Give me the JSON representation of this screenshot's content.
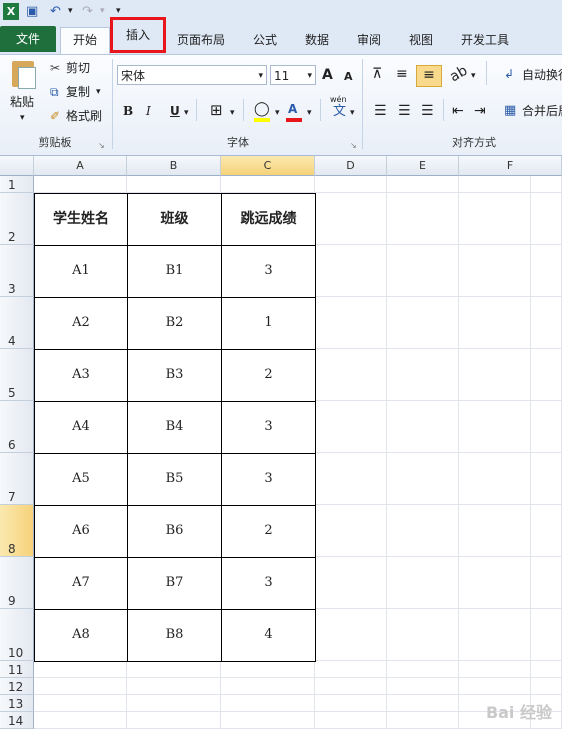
{
  "qat": {
    "excel_icon": "excel-app-icon",
    "save_icon": "save-icon",
    "undo_icon": "undo-icon",
    "redo_icon": "redo-icon"
  },
  "tabs": [
    {
      "label": "文件"
    },
    {
      "label": "开始"
    },
    {
      "label": "插入"
    },
    {
      "label": "页面布局"
    },
    {
      "label": "公式"
    },
    {
      "label": "数据"
    },
    {
      "label": "审阅"
    },
    {
      "label": "视图"
    },
    {
      "label": "开发工具"
    }
  ],
  "clipboard": {
    "paste": "粘贴",
    "cut": "剪切",
    "copy": "复制",
    "format_painter": "格式刷",
    "group": "剪贴板"
  },
  "font": {
    "name": "宋体",
    "size": "11",
    "group": "字体",
    "bold": "B",
    "italic": "I",
    "underline": "U",
    "grow": "A",
    "shrink": "A",
    "font_color": "A",
    "wen": "wén",
    "wen_char": "文"
  },
  "alignment": {
    "wrap": "自动换行",
    "merge": "合并后居",
    "group": "对齐方式"
  },
  "columns": [
    "A",
    "B",
    "C",
    "D",
    "E",
    "F"
  ],
  "rows": [
    "1",
    "2",
    "3",
    "4",
    "5",
    "6",
    "7",
    "8",
    "9",
    "10",
    "11",
    "12",
    "13",
    "14"
  ],
  "table": {
    "headers": [
      "学生姓名",
      "班级",
      "跳远成绩"
    ],
    "rows": [
      [
        "A1",
        "B1",
        "3"
      ],
      [
        "A2",
        "B2",
        "1"
      ],
      [
        "A3",
        "B3",
        "2"
      ],
      [
        "A4",
        "B4",
        "3"
      ],
      [
        "A5",
        "B5",
        "3"
      ],
      [
        "A6",
        "B6",
        "2"
      ],
      [
        "A7",
        "B7",
        "3"
      ],
      [
        "A8",
        "B8",
        "4"
      ]
    ]
  },
  "watermark": "Bai 经验",
  "colors": {
    "accent_red": "#e8151b",
    "file_tab": "#1f6f3d",
    "selection": "#f6d27a"
  }
}
